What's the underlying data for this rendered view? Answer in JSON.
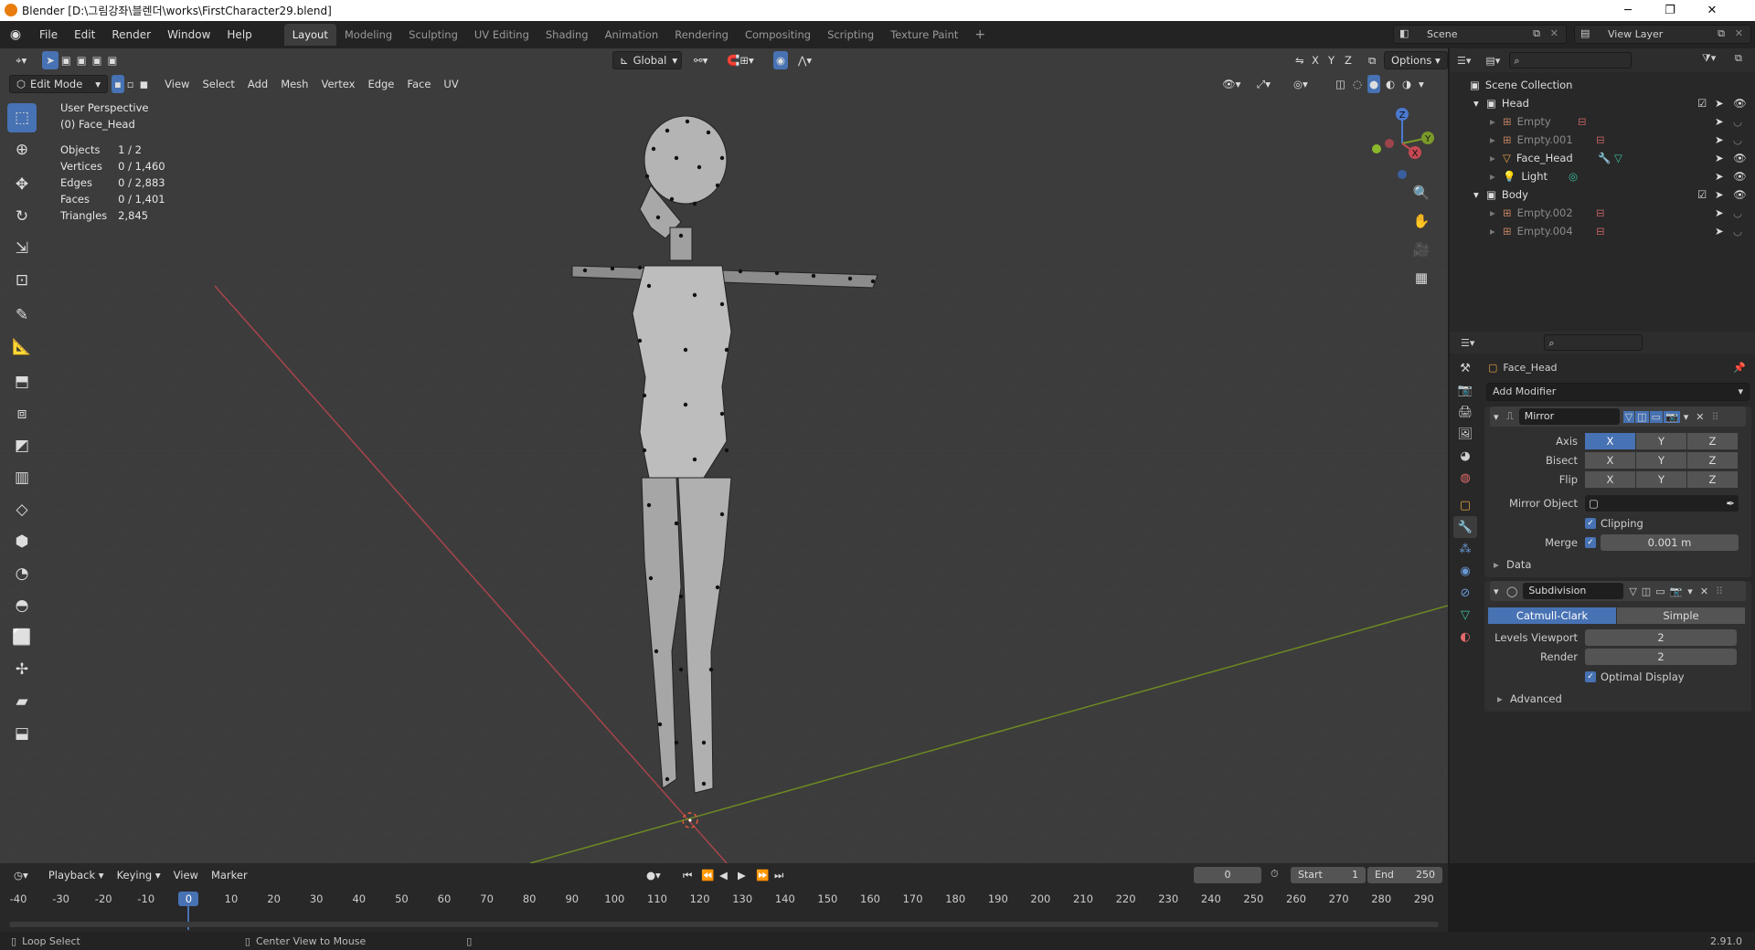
{
  "window": {
    "title": "Blender [D:\\그림강좌\\블렌더\\works\\FirstCharacter29.blend]",
    "minimize": "─",
    "maximize": "❐",
    "close": "✕"
  },
  "menus": [
    "File",
    "Edit",
    "Render",
    "Window",
    "Help"
  ],
  "workspaces": [
    "Layout",
    "Modeling",
    "Sculpting",
    "UV Editing",
    "Shading",
    "Animation",
    "Rendering",
    "Compositing",
    "Scripting",
    "Texture Paint"
  ],
  "scene": {
    "label": "Scene",
    "view_layer": "View Layer"
  },
  "viewport_header": {
    "orientation": "Global",
    "options": "Options",
    "axes": [
      "X",
      "Y",
      "Z"
    ],
    "mode": "Edit Mode",
    "menus": [
      "View",
      "Select",
      "Add",
      "Mesh",
      "Vertex",
      "Edge",
      "Face",
      "UV"
    ]
  },
  "overlay": {
    "perspective": "User Perspective",
    "object": "(0) Face_Head",
    "stats": [
      {
        "label": "Objects",
        "value": "1 / 2"
      },
      {
        "label": "Vertices",
        "value": "0 / 1,460"
      },
      {
        "label": "Edges",
        "value": "0 / 2,883"
      },
      {
        "label": "Faces",
        "value": "0 / 1,401"
      },
      {
        "label": "Triangles",
        "value": "2,845"
      }
    ]
  },
  "gizmo": {
    "z": "Z",
    "y": "Y",
    "x": "X"
  },
  "outliner": {
    "root": "Scene Collection",
    "items": [
      {
        "name": "Head",
        "level": 0,
        "dim": false
      },
      {
        "name": "Empty",
        "level": 1,
        "dim": true
      },
      {
        "name": "Empty.001",
        "level": 1,
        "dim": true
      },
      {
        "name": "Face_Head",
        "level": 1,
        "dim": false
      },
      {
        "name": "Light",
        "level": 1,
        "dim": false
      },
      {
        "name": "Body",
        "level": 0,
        "dim": false
      },
      {
        "name": "Empty.002",
        "level": 1,
        "dim": true
      },
      {
        "name": "Empty.004",
        "level": 1,
        "dim": true
      }
    ]
  },
  "properties": {
    "object": "Face_Head",
    "add_modifier": "Add Modifier",
    "mirror": {
      "name": "Mirror",
      "axis_label": "Axis",
      "bisect_label": "Bisect",
      "flip_label": "Flip",
      "xyz": [
        "X",
        "Y",
        "Z"
      ],
      "mirror_object_label": "Mirror Object",
      "clipping": "Clipping",
      "merge_label": "Merge",
      "merge_value": "0.001 m",
      "data": "Data"
    },
    "subdivision": {
      "name": "Subdivision",
      "catmull": "Catmull-Clark",
      "simple": "Simple",
      "levels_label": "Levels Viewport",
      "levels": "2",
      "render_label": "Render",
      "render": "2",
      "optimal": "Optimal Display",
      "advanced": "Advanced"
    }
  },
  "timeline": {
    "menus": [
      "Playback",
      "Keying",
      "View",
      "Marker"
    ],
    "current": "0",
    "start_label": "Start",
    "start": "1",
    "end_label": "End",
    "end": "250",
    "ticks": [
      "-40",
      "-30",
      "-20",
      "-10",
      "0",
      "10",
      "20",
      "30",
      "40",
      "50",
      "60",
      "70",
      "80",
      "90",
      "100",
      "110",
      "120",
      "130",
      "140",
      "150",
      "160",
      "170",
      "180",
      "190",
      "200",
      "210",
      "220",
      "230",
      "240",
      "250",
      "260",
      "270",
      "280",
      "290"
    ]
  },
  "status": {
    "left": "Loop Select",
    "middle": "Center View to Mouse",
    "version": "2.91.0"
  },
  "colors": {
    "accent": "#4772b3",
    "x_axis": "#c44852",
    "y_axis": "#7a9a2a",
    "z_axis": "#4a79d0"
  }
}
